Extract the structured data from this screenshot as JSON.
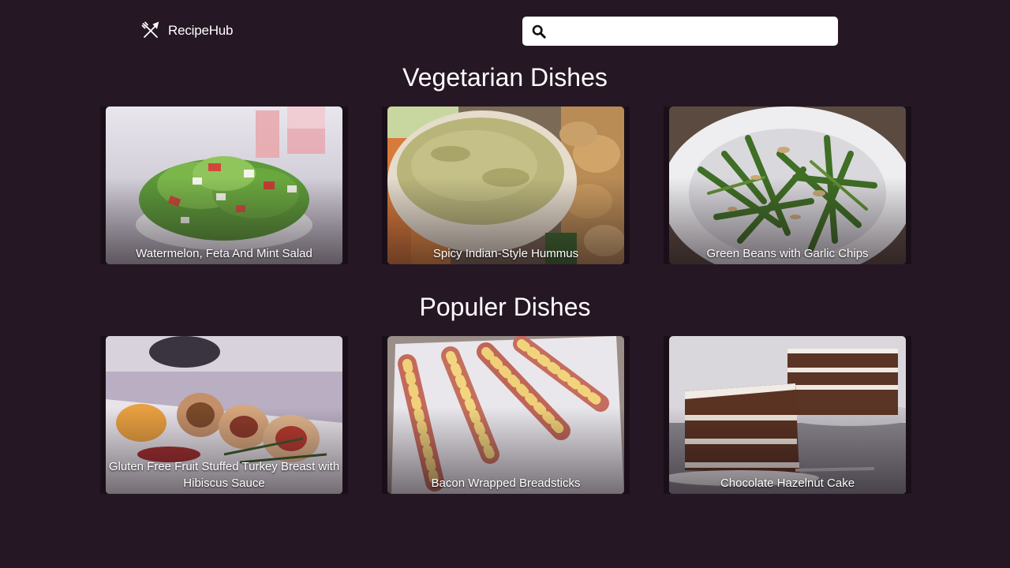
{
  "header": {
    "brand": "RecipeHub",
    "logo_icon": "fork-knife-icon",
    "search": {
      "icon": "search-icon",
      "placeholder": "",
      "value": ""
    }
  },
  "sections": [
    {
      "title": "Vegetarian Dishes",
      "recipes": [
        {
          "title": "Watermelon, Feta And Mint Salad"
        },
        {
          "title": "Spicy Indian-Style Hummus"
        },
        {
          "title": "Green Beans with Garlic Chips"
        }
      ]
    },
    {
      "title": "Populer Dishes",
      "recipes": [
        {
          "title": "Gluten Free Fruit Stuffed Turkey Breast with Hibiscus Sauce"
        },
        {
          "title": "Bacon Wrapped Breadsticks"
        },
        {
          "title": "Chocolate Hazelnut Cake"
        }
      ]
    }
  ],
  "colors": {
    "background": "#261724",
    "text": "#ffffff",
    "search_bg": "#ffffff"
  }
}
